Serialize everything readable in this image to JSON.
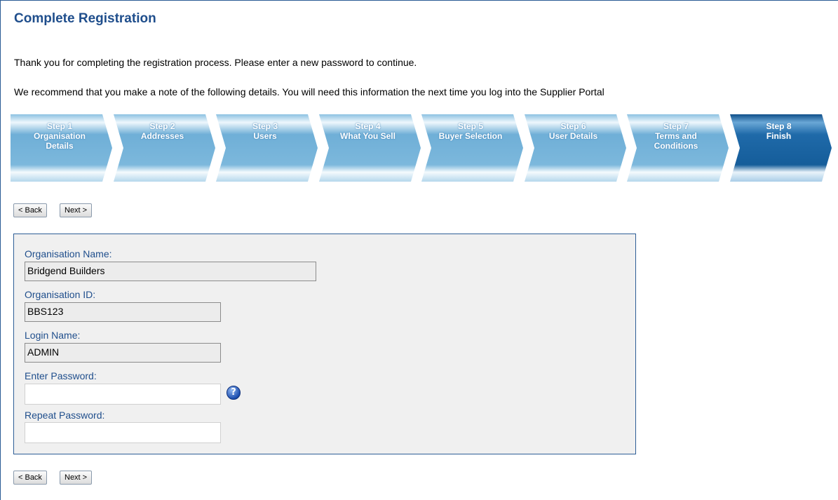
{
  "page": {
    "title": "Complete Registration",
    "intro": "Thank you for completing the registration process. Please enter a new password to continue.",
    "note": "We recommend that you make a note of the following details. You will need this information the next time you log into the Supplier Portal"
  },
  "steps": [
    {
      "step": "Step 1",
      "lines": [
        "Organisation",
        "Details"
      ],
      "active": false
    },
    {
      "step": "Step 2",
      "lines": [
        "Addresses"
      ],
      "active": false
    },
    {
      "step": "Step 3",
      "lines": [
        "Users"
      ],
      "active": false
    },
    {
      "step": "Step 4",
      "lines": [
        "What You Sell"
      ],
      "active": false
    },
    {
      "step": "Step 5",
      "lines": [
        "Buyer Selection"
      ],
      "active": false
    },
    {
      "step": "Step 6",
      "lines": [
        "User Details"
      ],
      "active": false
    },
    {
      "step": "Step 7",
      "lines": [
        "Terms and",
        "Conditions"
      ],
      "active": false
    },
    {
      "step": "Step 8",
      "lines": [
        "Finish"
      ],
      "active": true
    }
  ],
  "nav": {
    "back_label": "< Back",
    "next_label": "Next >"
  },
  "form": {
    "org_name": {
      "label": "Organisation Name:",
      "value": "Bridgend Builders"
    },
    "org_id": {
      "label": "Organisation ID:",
      "value": "BBS123"
    },
    "login_name": {
      "label": "Login Name:",
      "value": "ADMIN"
    },
    "password": {
      "label": "Enter Password:",
      "value": ""
    },
    "repeat_password": {
      "label": "Repeat Password:",
      "value": ""
    },
    "help_icon": "help-question-icon"
  },
  "colors": {
    "title": "#1f4e8c",
    "step_inactive": "#7fb6d9",
    "step_active": "#1c67a8",
    "panel_border": "#2d5d96"
  }
}
